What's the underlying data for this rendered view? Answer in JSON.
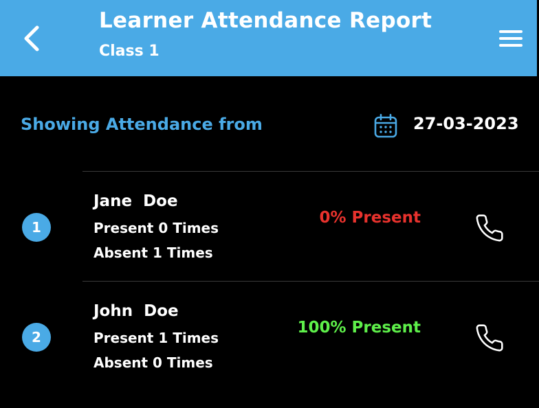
{
  "header": {
    "title": "Learner Attendance Report",
    "subtitle": "Class 1",
    "back_icon": "chevron-left-icon",
    "menu_icon": "hamburger-menu-icon"
  },
  "filter": {
    "label": "Showing Attendance from",
    "date": "27-03-2023",
    "calendar_icon": "calendar-icon"
  },
  "colors": {
    "accent": "#4aaae6",
    "absent": "#e8322d",
    "present": "#5ef04a"
  },
  "learners": [
    {
      "index": "1",
      "name": "Jane  Doe",
      "present": "Present 0 Times",
      "absent": "Absent 1 Times",
      "percent": "0% Present",
      "status": "absent"
    },
    {
      "index": "2",
      "name": "John  Doe",
      "present": "Present 1 Times",
      "absent": "Absent 0 Times",
      "percent": "100% Present",
      "status": "present"
    }
  ]
}
